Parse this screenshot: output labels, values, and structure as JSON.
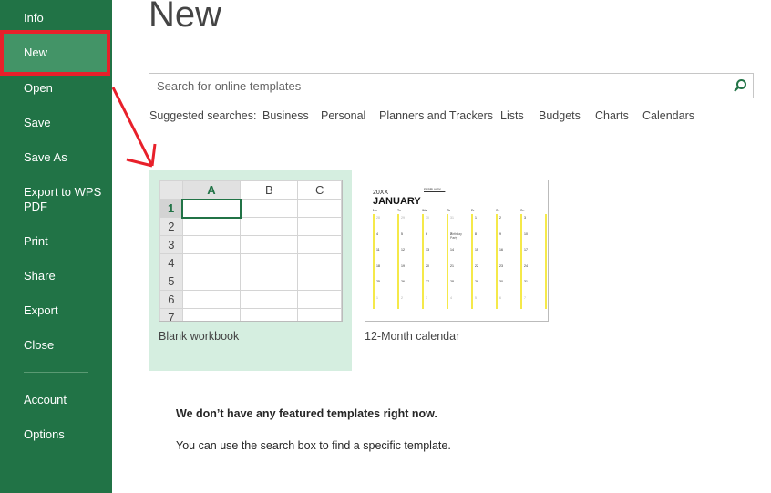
{
  "sidebar": {
    "items": [
      "Info",
      "New",
      "Open",
      "Save",
      "Save As",
      "Export to WPS PDF",
      "Print",
      "Share",
      "Export",
      "Close",
      "Account",
      "Options"
    ]
  },
  "page_title": "New",
  "search": {
    "placeholder": "Search for online templates"
  },
  "suggested": {
    "label": "Suggested searches:",
    "items": [
      "Business",
      "Personal",
      "Planners and Trackers",
      "Lists",
      "Budgets",
      "Charts",
      "Calendars"
    ]
  },
  "templates": [
    {
      "label": "Blank workbook",
      "columns": [
        "A",
        "B",
        "C"
      ],
      "rows": [
        "1",
        "2",
        "3",
        "4",
        "5",
        "6",
        "7"
      ]
    },
    {
      "label": "12-Month calendar",
      "year": "20XX",
      "month": "JANUARY",
      "next": "FEBRUARY →",
      "weekdays": [
        "Mo",
        "Tu",
        "We",
        "Th",
        "Fr",
        "Sa",
        "Su"
      ],
      "days": [
        "28",
        "29",
        "30",
        "31",
        "1",
        "2",
        "3",
        "4",
        "5",
        "6",
        "7",
        "8",
        "9",
        "10",
        "11",
        "12",
        "13",
        "14",
        "15",
        "16",
        "17",
        "18",
        "19",
        "20",
        "21",
        "22",
        "23",
        "24",
        "25",
        "26",
        "27",
        "28",
        "29",
        "30",
        "31",
        "1",
        "2",
        "3",
        "4",
        "5",
        "6",
        "7"
      ],
      "event": "Birthday Party"
    }
  ],
  "messages": {
    "heading": "We don’t have any featured templates right now.",
    "body": "You can use the search box to find a specific template."
  },
  "colors": {
    "sidebar": "#217346",
    "selected": "#439467",
    "tile": "#d5eee0",
    "annotation": "#e8202a"
  }
}
